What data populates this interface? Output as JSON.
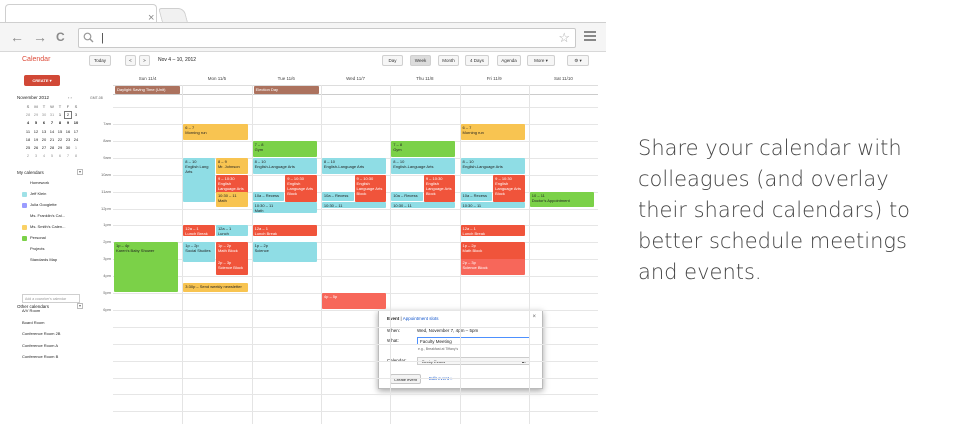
{
  "browser": {
    "tab_close_glyph": "×",
    "back_glyph": "←",
    "forward_glyph": "→",
    "reload_glyph": "C",
    "address_text": "|",
    "star_glyph": "☆"
  },
  "app": {
    "logo": "Calendar",
    "today_label": "Today",
    "prev_glyph": "<",
    "next_glyph": ">",
    "date_range": "Nov 4 – 10, 2012",
    "views": [
      "Day",
      "Week",
      "Month",
      "4 Days",
      "Agenda"
    ],
    "active_view": "Week",
    "more_label": "More ▾",
    "settings_glyph": "⚙ ▾",
    "create_label": "CREATE",
    "create_arrow": "▾"
  },
  "mini_calendar": {
    "title": "November 2012",
    "arrows": "‹ ›",
    "weekdays": [
      "S",
      "M",
      "T",
      "W",
      "T",
      "F",
      "S"
    ],
    "weeks": [
      [
        "28",
        "29",
        "30",
        "31",
        "1",
        "2",
        "3"
      ],
      [
        "4",
        "5",
        "6",
        "7",
        "8",
        "9",
        "10"
      ],
      [
        "11",
        "12",
        "13",
        "14",
        "15",
        "16",
        "17"
      ],
      [
        "18",
        "19",
        "20",
        "21",
        "22",
        "23",
        "24"
      ],
      [
        "25",
        "26",
        "27",
        "28",
        "29",
        "30",
        "1"
      ],
      [
        "2",
        "3",
        "4",
        "5",
        "6",
        "7",
        "8"
      ]
    ]
  },
  "my_calendars": {
    "title": "My calendars",
    "toggle": "▾",
    "items": [
      {
        "label": "Homework",
        "color": ""
      },
      {
        "label": "Jeff Klein",
        "color": "#9fe1e7"
      },
      {
        "label": "Julia Googlette",
        "color": "#9a9cff"
      },
      {
        "label": "Ms. Franklin's Cal...",
        "color": ""
      },
      {
        "label": "Ms. Smith's Calen...",
        "color": "#fad165"
      },
      {
        "label": "Personal",
        "color": "#7bd148"
      },
      {
        "label": "Projects",
        "color": ""
      },
      {
        "label": "Standards Map",
        "color": ""
      }
    ]
  },
  "other_calendars": {
    "title": "Other calendars",
    "toggle": "▾",
    "placeholder": "Add a coworker's calendar",
    "items": [
      "A/V Room",
      "Board Room",
      "Conference Room 2B",
      "Conference Room A",
      "Conference Room B"
    ]
  },
  "week": {
    "days": [
      "Sun 11/4",
      "Mon 11/5",
      "Tue 11/6",
      "Wed 11/7",
      "Thu 11/8",
      "Fri 11/9",
      "Sat 11/10"
    ],
    "gmt": "GMT-08",
    "hours": [
      "7am",
      "8am",
      "9am",
      "10am",
      "11am",
      "12pm",
      "1pm",
      "2pm",
      "3pm",
      "4pm",
      "5pm",
      "6pm"
    ],
    "allday_events": [
      {
        "label": "Daylight Saving Time (Unit)",
        "day": 0,
        "color": "#ac725e"
      },
      {
        "label": "Election Day",
        "day": 2,
        "color": "#ac725e"
      }
    ],
    "events": [
      {
        "day": 1,
        "start": 6.0,
        "end": 7.0,
        "color": "orange",
        "time": "6 – 7",
        "title": "Morning run"
      },
      {
        "day": 5,
        "start": 6.0,
        "end": 7.0,
        "color": "orange",
        "time": "6 – 7",
        "title": "Morning run"
      },
      {
        "day": 2,
        "start": 7.0,
        "end": 8.0,
        "color": "green",
        "time": "7 – 8",
        "title": "Gym"
      },
      {
        "day": 4,
        "start": 7.0,
        "end": 8.0,
        "color": "green",
        "time": "7 – 8",
        "title": "Gym"
      },
      {
        "day": 1,
        "start": 8.0,
        "end": 10.7,
        "color": "cyan",
        "time": "8 – 10",
        "title": "English Lang Arts",
        "sub": 0,
        "subs": 2
      },
      {
        "day": 1,
        "start": 8.0,
        "end": 9.0,
        "color": "orange",
        "time": "8 – 9",
        "title": "Mr. Johnson",
        "sub": 1,
        "subs": 2
      },
      {
        "day": 2,
        "start": 8.0,
        "end": 9.0,
        "color": "cyan",
        "time": "8 – 10",
        "title": "English-Language Arts"
      },
      {
        "day": 3,
        "start": 8.0,
        "end": 9.0,
        "color": "cyan",
        "time": "8 – 10",
        "title": "English-Language Arts"
      },
      {
        "day": 4,
        "start": 8.0,
        "end": 9.0,
        "color": "cyan",
        "time": "8 – 10",
        "title": "English-Language Arts"
      },
      {
        "day": 5,
        "start": 8.0,
        "end": 9.0,
        "color": "cyan",
        "time": "8 – 10",
        "title": "English-Language Arts"
      },
      {
        "day": 1,
        "start": 9.0,
        "end": 10.7,
        "color": "red",
        "time": "9 – 10:30",
        "title": "English Language Arts Block",
        "sub": 1,
        "subs": 2
      },
      {
        "day": 2,
        "start": 9.0,
        "end": 10.7,
        "color": "red",
        "time": "9 – 10:30",
        "title": "English Language Arts Block",
        "sub": 1,
        "subs": 2
      },
      {
        "day": 3,
        "start": 9.0,
        "end": 10.7,
        "color": "red",
        "time": "9 – 10:30",
        "title": "English Language Arts Block",
        "sub": 1,
        "subs": 2
      },
      {
        "day": 4,
        "start": 9.0,
        "end": 10.7,
        "color": "red",
        "time": "9 – 10:30",
        "title": "English Language Arts Block",
        "sub": 1,
        "subs": 2
      },
      {
        "day": 5,
        "start": 9.0,
        "end": 10.7,
        "color": "red",
        "time": "9 – 10:30",
        "title": "English Language Arts Block",
        "sub": 1,
        "subs": 2
      },
      {
        "day": 2,
        "start": 10.0,
        "end": 10.6,
        "color": "cyan",
        "time": "",
        "title": "10a – Recess",
        "sub": 0,
        "subs": 2
      },
      {
        "day": 3,
        "start": 10.0,
        "end": 10.6,
        "color": "cyan",
        "time": "",
        "title": "10a – Recess",
        "sub": 0,
        "subs": 2
      },
      {
        "day": 4,
        "start": 10.0,
        "end": 10.6,
        "color": "cyan",
        "time": "",
        "title": "10a – Recess",
        "sub": 0,
        "subs": 2
      },
      {
        "day": 5,
        "start": 10.0,
        "end": 10.6,
        "color": "cyan",
        "time": "",
        "title": "10a – Recess",
        "sub": 0,
        "subs": 2
      },
      {
        "day": 6,
        "start": 10.0,
        "end": 11.0,
        "color": "green",
        "time": "10 – 11",
        "title": "Doctor's Appointment"
      },
      {
        "day": 1,
        "start": 10.0,
        "end": 11.0,
        "color": "orange",
        "time": "10:30 – 11",
        "title": "Math",
        "sub": 1,
        "subs": 2
      },
      {
        "day": 2,
        "start": 10.6,
        "end": 11.3,
        "color": "cyan",
        "time": "10:30 – 11",
        "title": "Math"
      },
      {
        "day": 3,
        "start": 10.6,
        "end": 11.0,
        "color": "cyan",
        "time": "10:30 – 11",
        "title": "Math"
      },
      {
        "day": 4,
        "start": 10.6,
        "end": 11.0,
        "color": "cyan",
        "time": "10:30 – 11",
        "title": "Math"
      },
      {
        "day": 5,
        "start": 10.6,
        "end": 11.0,
        "color": "cyan",
        "time": "10:30 – 11",
        "title": "Math"
      },
      {
        "day": 1,
        "start": 12.0,
        "end": 12.7,
        "color": "red",
        "time": "12a – 1",
        "title": "Lunch Break",
        "sub": 0,
        "subs": 2
      },
      {
        "day": 1,
        "start": 12.0,
        "end": 12.7,
        "color": "cyan",
        "time": "12a – 1",
        "title": "Lunch",
        "sub": 1,
        "subs": 2
      },
      {
        "day": 2,
        "start": 12.0,
        "end": 12.7,
        "color": "red",
        "time": "12a – 1",
        "title": "Lunch Break"
      },
      {
        "day": 5,
        "start": 12.0,
        "end": 12.7,
        "color": "red",
        "time": "12a – 1",
        "title": "Lunch Break"
      },
      {
        "day": 0,
        "start": 13.0,
        "end": 16.0,
        "color": "green",
        "time": "1p – 4p",
        "title": "Karen's Baby Shower"
      },
      {
        "day": 1,
        "start": 13.0,
        "end": 14.2,
        "color": "cyan",
        "time": "1p – 2p",
        "title": "Social Studies",
        "sub": 0,
        "subs": 2
      },
      {
        "day": 1,
        "start": 13.0,
        "end": 14.2,
        "color": "red",
        "time": "1p – 2p",
        "title": "Math Block",
        "sub": 1,
        "subs": 2
      },
      {
        "day": 2,
        "start": 13.0,
        "end": 14.2,
        "color": "cyan",
        "time": "1p – 2p",
        "title": "Science"
      },
      {
        "day": 5,
        "start": 13.0,
        "end": 14.2,
        "color": "red",
        "time": "1p – 2p",
        "title": "Math Block"
      },
      {
        "day": 1,
        "start": 14.0,
        "end": 15.0,
        "color": "red",
        "time": "2p – 3p",
        "title": "Science Block",
        "sub": 1,
        "subs": 2
      },
      {
        "day": 5,
        "start": 14.0,
        "end": 15.0,
        "color": "salmon",
        "time": "2p – 3p",
        "title": "Science Block"
      },
      {
        "day": 1,
        "start": 15.4,
        "end": 16.0,
        "color": "orange",
        "time": "",
        "title": "3:30p – Send weekly newsletter"
      },
      {
        "day": 3,
        "start": 16.0,
        "end": 17.0,
        "color": "salmon",
        "time": "4p – 5p",
        "title": ""
      }
    ]
  },
  "popup": {
    "event_word": "Event",
    "separator": " | ",
    "appointment_link": "Appointment slots",
    "close_glyph": "×",
    "when_label": "When:",
    "when_value": "Wed, November 7, 4pm – 5pm",
    "what_label": "What:",
    "what_value": "Faculty Meeting",
    "hint": "e.g., Breakfast at Tiffany's",
    "calendar_label": "Calendar:",
    "calendar_value": "Becky Evans",
    "calendar_arrow": "▴▾",
    "create_button": "Create event",
    "edit_link": "Edit event »"
  },
  "caption": "Share your calendar with colleagues (and overlay their shared calendars) to better schedule meetings and events."
}
